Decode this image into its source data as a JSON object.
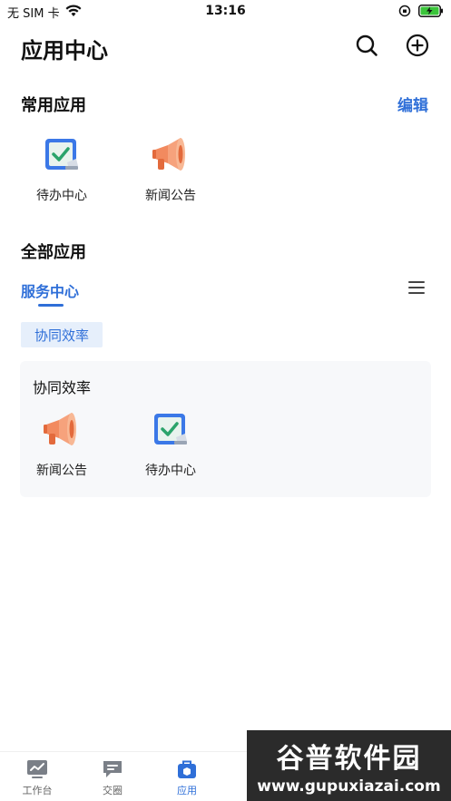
{
  "status_bar": {
    "carrier": "无 SIM 卡",
    "time": "13:16",
    "wifi_icon": "wifi-icon",
    "orientation_icon": "orientation-lock-icon",
    "battery_icon": "battery-charging-icon"
  },
  "header": {
    "title": "应用中心",
    "search_icon": "search-icon",
    "add_icon": "plus-circle-icon"
  },
  "common_apps": {
    "title": "常用应用",
    "edit_label": "编辑",
    "items": [
      {
        "label": "待办中心",
        "icon": "todo-checkbox-icon"
      },
      {
        "label": "新闻公告",
        "icon": "megaphone-icon"
      }
    ]
  },
  "all_apps": {
    "title": "全部应用",
    "active_tab": "服务中心",
    "menu_icon": "hamburger-menu-icon",
    "chip": "协同效率",
    "groups": [
      {
        "title": "协同效率",
        "items": [
          {
            "label": "新闻公告",
            "icon": "megaphone-icon"
          },
          {
            "label": "待办中心",
            "icon": "todo-checkbox-icon"
          }
        ]
      }
    ]
  },
  "bottom_nav": {
    "items": [
      {
        "label": "工作台",
        "icon": "workbench-chart-icon",
        "active": false
      },
      {
        "label": "交圈",
        "icon": "chat-bubble-icon",
        "active": false
      },
      {
        "label": "应用",
        "icon": "app-box-icon",
        "active": true
      }
    ]
  },
  "watermark": {
    "main": "谷普软件园",
    "url": "www.gupuxiazai.com"
  },
  "colors": {
    "accent": "#2f6fd8",
    "chip_bg": "#e6effb",
    "card_bg": "#f7f8fa"
  }
}
